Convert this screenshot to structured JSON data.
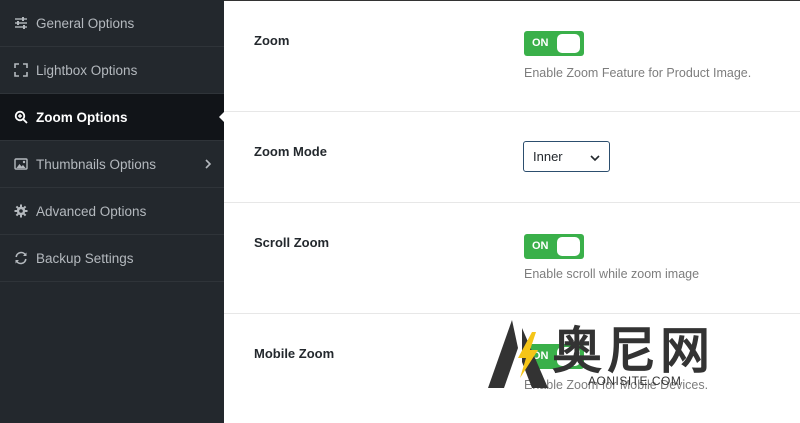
{
  "sidebar": {
    "items": [
      {
        "label": "General Options",
        "icon": "sliders-icon"
      },
      {
        "label": "Lightbox Options",
        "icon": "expand-icon"
      },
      {
        "label": "Zoom Options",
        "icon": "zoom-in-icon",
        "active": true
      },
      {
        "label": "Thumbnails Options",
        "icon": "image-icon"
      },
      {
        "label": "Advanced Options",
        "icon": "gear-icon"
      },
      {
        "label": "Backup Settings",
        "icon": "refresh-icon"
      }
    ]
  },
  "settings": {
    "zoom": {
      "label": "Zoom",
      "toggle": "ON",
      "description": "Enable Zoom Feature for Product Image."
    },
    "zoom_mode": {
      "label": "Zoom Mode",
      "value": "Inner"
    },
    "scroll_zoom": {
      "label": "Scroll Zoom",
      "toggle": "ON",
      "description": "Enable scroll while zoom image"
    },
    "mobile_zoom": {
      "label": "Mobile Zoom",
      "toggle": "ON",
      "description": "Enable Zoom for Mobile Devices."
    }
  },
  "watermark": {
    "chinese": "奥尼网",
    "site": "AONISITE.COM"
  },
  "colors": {
    "sidebar_bg": "#23282d",
    "active_bg": "#111418",
    "toggle_on": "#3ab04a",
    "accent_yellow": "#f5c518"
  }
}
